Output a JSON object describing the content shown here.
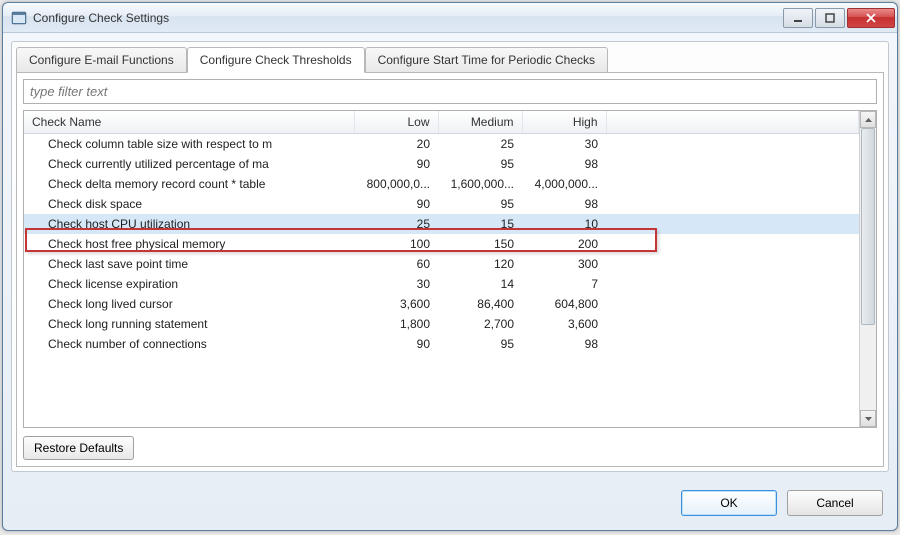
{
  "window": {
    "title": "Configure Check Settings"
  },
  "tabs": {
    "items": [
      {
        "label": "Configure E-mail Functions"
      },
      {
        "label": "Configure Check Thresholds"
      },
      {
        "label": "Configure Start Time for Periodic Checks"
      }
    ]
  },
  "filter": {
    "placeholder": "type filter text"
  },
  "table": {
    "headers": {
      "name": "Check Name",
      "low": "Low",
      "medium": "Medium",
      "high": "High"
    },
    "rows": [
      {
        "name": "Check column table size with respect to m",
        "low": "20",
        "medium": "25",
        "high": "30"
      },
      {
        "name": "Check currently utilized percentage of ma",
        "low": "90",
        "medium": "95",
        "high": "98"
      },
      {
        "name": "Check delta memory record count * table",
        "low": "800,000,0...",
        "medium": "1,600,000...",
        "high": "4,000,000..."
      },
      {
        "name": "Check disk space",
        "low": "90",
        "medium": "95",
        "high": "98"
      },
      {
        "name": "Check host CPU utilization",
        "low": "25",
        "medium": "15",
        "high": "10"
      },
      {
        "name": "Check host free physical memory",
        "low": "100",
        "medium": "150",
        "high": "200"
      },
      {
        "name": "Check last save point time",
        "low": "60",
        "medium": "120",
        "high": "300"
      },
      {
        "name": "Check license expiration",
        "low": "30",
        "medium": "14",
        "high": "7"
      },
      {
        "name": "Check long lived cursor",
        "low": "3,600",
        "medium": "86,400",
        "high": "604,800"
      },
      {
        "name": "Check long running statement",
        "low": "1,800",
        "medium": "2,700",
        "high": "3,600"
      },
      {
        "name": "Check number of connections",
        "low": "90",
        "medium": "95",
        "high": "98"
      }
    ]
  },
  "buttons": {
    "restore_defaults": "Restore Defaults",
    "ok": "OK",
    "cancel": "Cancel"
  }
}
